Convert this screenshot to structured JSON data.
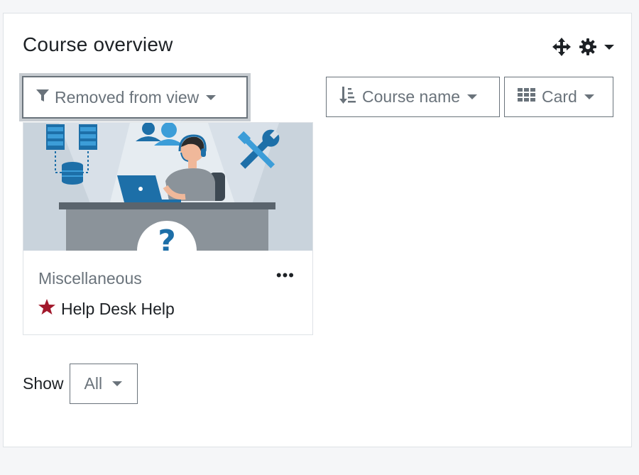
{
  "block": {
    "title": "Course overview",
    "header_icons": [
      "move-icon",
      "gear-icon",
      "caret-down-icon"
    ]
  },
  "filter": {
    "label": "Removed from view",
    "icon": "filter-icon"
  },
  "sort": {
    "label": "Course name",
    "icon": "sort-icon"
  },
  "view": {
    "label": "Card",
    "icon": "grid-icon"
  },
  "courses": [
    {
      "category": "Miscellaneous",
      "name": "Help Desk Help",
      "starred": true,
      "menu": "•••"
    }
  ],
  "paging": {
    "show_label": "Show",
    "value": "All"
  },
  "colors": {
    "accent": "#0f6cbf",
    "star": "#a2182b",
    "muted": "#6a737b",
    "text": "#1d2125"
  }
}
